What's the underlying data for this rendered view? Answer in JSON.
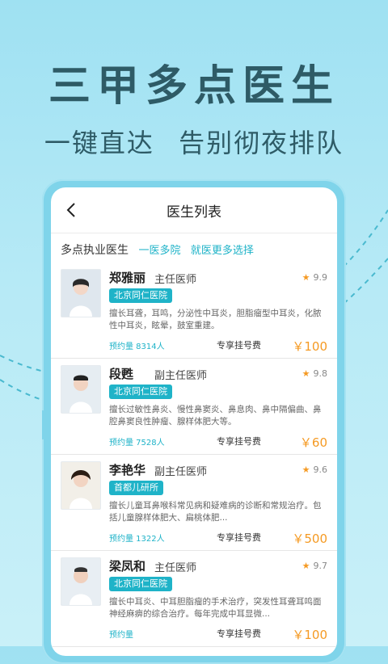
{
  "headline": "三甲多点医生",
  "subline": "一键直达 告别彻夜排队",
  "screen": {
    "nav_title": "医生列表",
    "subhead_label": "多点执业医生",
    "subhead_tags": [
      "一医多院",
      "就医更多选择"
    ],
    "doctors": [
      {
        "name": "郑雅丽",
        "title": "主任医师",
        "rating": "9.9",
        "hospital": "北京同仁医院",
        "desc": "擅长耳聋，耳鸣，分泌性中耳炎，胆脂瘤型中耳炎，化脓性中耳炎，眩晕，鼓室重建。",
        "appointments": "预约量 8314人",
        "fee_label": "专享挂号费",
        "fee": "￥100"
      },
      {
        "name": "段甦",
        "title": "副主任医师",
        "rating": "9.8",
        "hospital": "北京同仁医院",
        "desc": "擅长过敏性鼻炎、慢性鼻窦炎、鼻息肉、鼻中隔偏曲、鼻腔鼻窦良性肿瘤、腺样体肥大等。",
        "appointments": "预约量 7528人",
        "fee_label": "专享挂号费",
        "fee": "￥60"
      },
      {
        "name": "李艳华",
        "title": "副主任医师",
        "rating": "9.6",
        "hospital": "首都儿研所",
        "desc": "擅长儿童耳鼻喉科常见病和疑难病的诊断和常规治疗。包括儿童腺样体肥大、扁桃体肥...",
        "appointments": "预约量 1322人",
        "fee_label": "专享挂号费",
        "fee": "￥500"
      },
      {
        "name": "梁凤和",
        "title": "主任医师",
        "rating": "9.7",
        "hospital": "北京同仁医院",
        "desc": "擅长中耳炎、中耳胆脂瘤的手术治疗，突发性耳聋耳鸣面神经麻痹的综合治疗。每年完成中耳显微...",
        "appointments": "预约量",
        "fee_label": "专享挂号费",
        "fee": "￥100"
      }
    ]
  },
  "colors": {
    "accent": "#1fb3c8",
    "price": "#f59a23",
    "headline": "#2e5b66"
  }
}
